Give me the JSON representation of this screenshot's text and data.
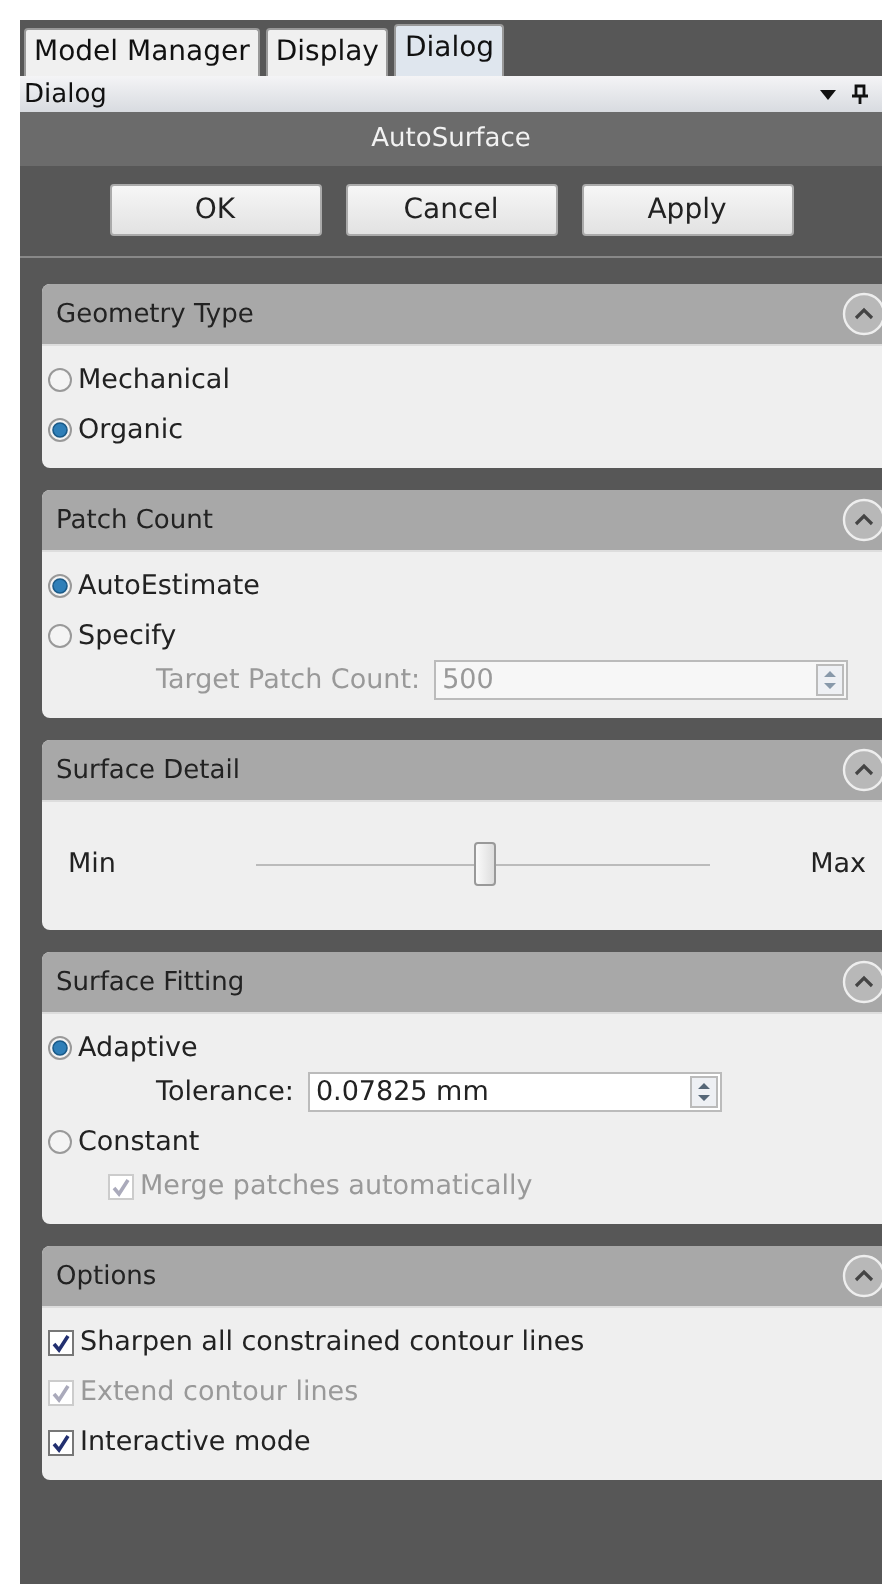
{
  "tabs": [
    {
      "label": "Model Manager",
      "selected": false
    },
    {
      "label": "Display",
      "selected": false
    },
    {
      "label": "Dialog",
      "selected": true
    }
  ],
  "pane": {
    "title": "Dialog"
  },
  "dialog": {
    "title": "AutoSurface",
    "buttons": [
      "OK",
      "Cancel",
      "Apply"
    ]
  },
  "sections": [
    {
      "title": "Geometry Type",
      "expanded": true,
      "items": [
        {
          "kind": "radio",
          "label": "Mechanical",
          "selected": false
        },
        {
          "kind": "radio",
          "label": "Organic",
          "selected": true
        }
      ]
    },
    {
      "title": "Patch Count",
      "expanded": true,
      "items": [
        {
          "kind": "radio",
          "label": "AutoEstimate",
          "selected": true
        },
        {
          "kind": "radio",
          "label": "Specify",
          "selected": false,
          "children": [
            {
              "kind": "spin",
              "label": "Target Patch Count:",
              "value": "500",
              "disabled": true
            }
          ]
        }
      ]
    },
    {
      "title": "Surface Detail",
      "expanded": true,
      "items": [
        {
          "kind": "slider",
          "min_label": "Min",
          "max_label": "Max",
          "level": 0.5
        }
      ]
    },
    {
      "title": "Surface Fitting",
      "expanded": true,
      "items": [
        {
          "kind": "radio",
          "label": "Adaptive",
          "selected": true,
          "children": [
            {
              "kind": "spin",
              "label": "Tolerance:",
              "value": "0.07825 mm",
              "disabled": false
            }
          ]
        },
        {
          "kind": "radio",
          "label": "Constant",
          "selected": false,
          "children": [
            {
              "kind": "checkbox",
              "label": "Merge patches automatically",
              "checked": true,
              "disabled": true
            }
          ]
        }
      ]
    },
    {
      "title": "Options",
      "expanded": true,
      "items": [
        {
          "kind": "checkbox",
          "label": "Sharpen all constrained contour lines",
          "checked": true,
          "disabled": false
        },
        {
          "kind": "checkbox",
          "label": "Extend contour lines",
          "checked": true,
          "disabled": true
        },
        {
          "kind": "checkbox",
          "label": "Interactive mode",
          "checked": true,
          "disabled": false
        }
      ]
    }
  ]
}
